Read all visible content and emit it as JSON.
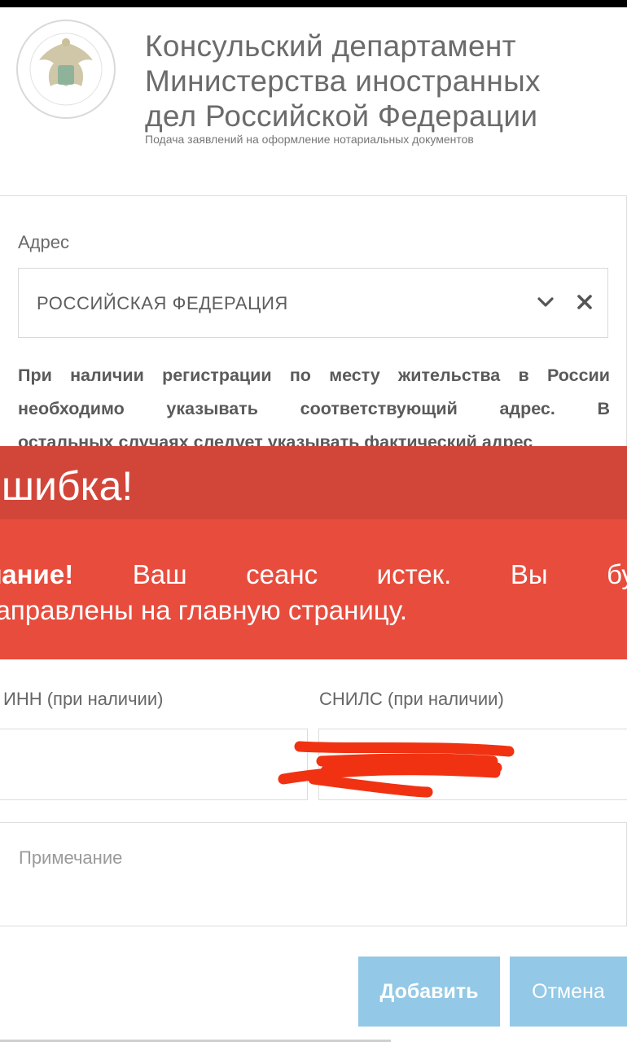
{
  "header": {
    "title_lines": [
      "Консульский департамент",
      "Министерства иностранных",
      "дел Российской Федерации"
    ],
    "subtitle": "Подача заявлений на оформление нотариальных документов",
    "logo_icon": "ministry-emblem-icon"
  },
  "address": {
    "label": "Адрес",
    "selected_value": "РОССИЙСКАЯ ФЕДЕРАЦИЯ",
    "note_lines": [
      "При наличии регистрации по месту жительства в России",
      "необходимо указывать соответствующий адрес. В",
      "остальных случаях следует указывать фактический адрес"
    ]
  },
  "alert": {
    "title": "ишибка!",
    "message_bold": "имание!",
    "message_words": [
      "Ваш",
      "сеанс",
      "истек.",
      "Вы",
      "буд"
    ],
    "message_line2": "енаправлены на главную страницу.",
    "background_color": "#e84c3d",
    "header_color": "#d2463a"
  },
  "fields": {
    "inn_label": "ИНН (при наличии)",
    "snils_label": "СНИЛС (при наличии)",
    "note_placeholder": "Примечание"
  },
  "buttons": {
    "add_label": "Добавить",
    "cancel_label": "Отмена",
    "color": "#93c8e6"
  }
}
